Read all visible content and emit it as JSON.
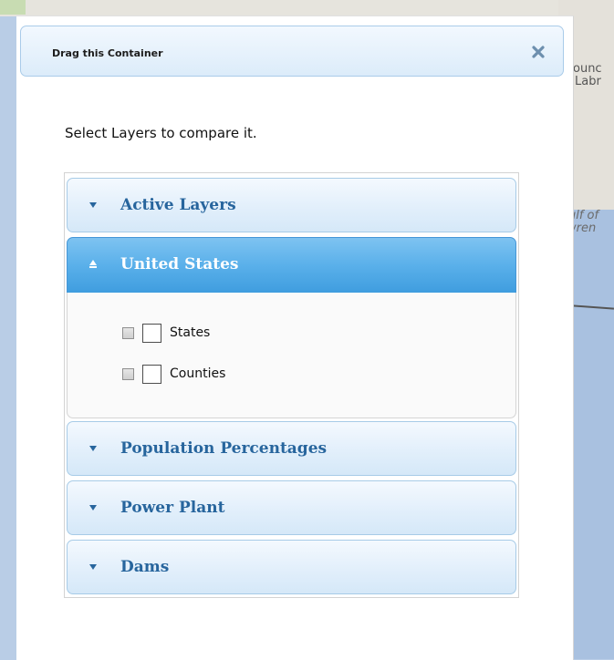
{
  "map": {
    "labels": [
      "ounc",
      "Labr",
      "ulf of",
      "wren"
    ]
  },
  "panel": {
    "title": "Drag this Container",
    "close_icon": "close-x-icon",
    "instructions": "Select Layers to compare it."
  },
  "accordion": {
    "sections": [
      {
        "label": "Active Layers",
        "expanded": false
      },
      {
        "label": "United States",
        "expanded": true
      },
      {
        "label": "Population Percentages",
        "expanded": false
      },
      {
        "label": "Power Plant",
        "expanded": false
      },
      {
        "label": "Dams",
        "expanded": false
      }
    ],
    "united_states_layers": [
      {
        "label": "States",
        "checked": false
      },
      {
        "label": "Counties",
        "checked": false
      }
    ]
  },
  "colors": {
    "header_text": "#27659d",
    "active_header": "#5ab0ea",
    "panel_header_border": "#a9cbe9"
  }
}
